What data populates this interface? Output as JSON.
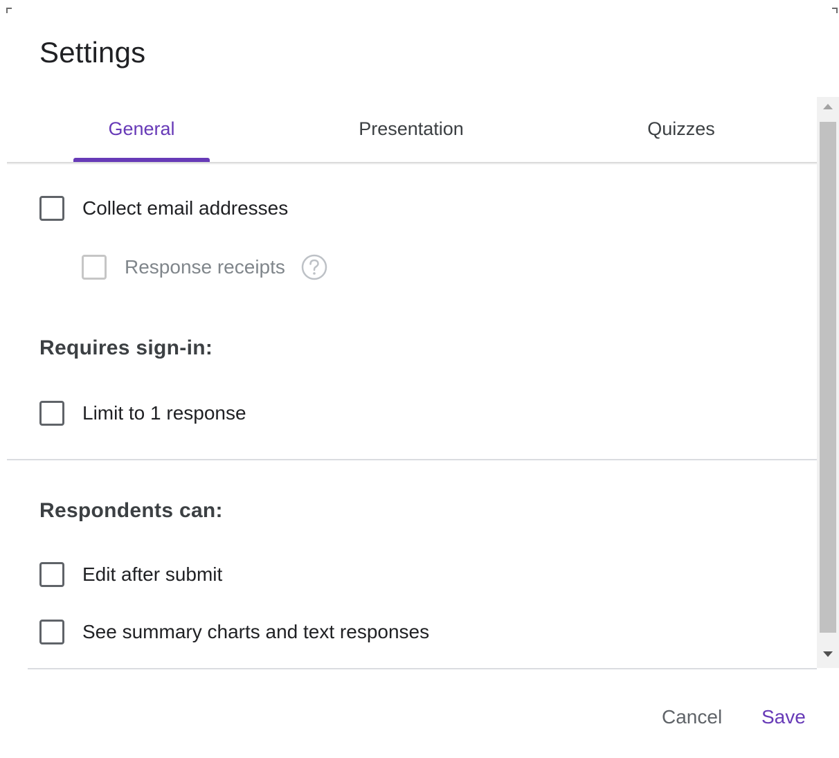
{
  "dialog": {
    "title": "Settings"
  },
  "tabs": [
    {
      "label": "General",
      "active": true
    },
    {
      "label": "Presentation",
      "active": false
    },
    {
      "label": "Quizzes",
      "active": false
    }
  ],
  "general": {
    "collect_email": {
      "label": "Collect email addresses",
      "checked": false
    },
    "response_receipts": {
      "label": "Response receipts",
      "checked": false,
      "disabled": true,
      "help_icon": "help-circle-icon"
    },
    "requires_sign_in": {
      "heading": "Requires sign-in:",
      "limit_one": {
        "label": "Limit to 1 response",
        "checked": false
      }
    },
    "respondents_can": {
      "heading": "Respondents can:",
      "edit_after_submit": {
        "label": "Edit after submit",
        "checked": false
      },
      "see_summary": {
        "label": "See summary charts and text responses",
        "checked": false
      }
    }
  },
  "footer": {
    "cancel_label": "Cancel",
    "save_label": "Save"
  },
  "colors": {
    "accent": "#673ab7",
    "text": "#202124",
    "muted": "#5f6368",
    "divider": "#dadce0"
  }
}
